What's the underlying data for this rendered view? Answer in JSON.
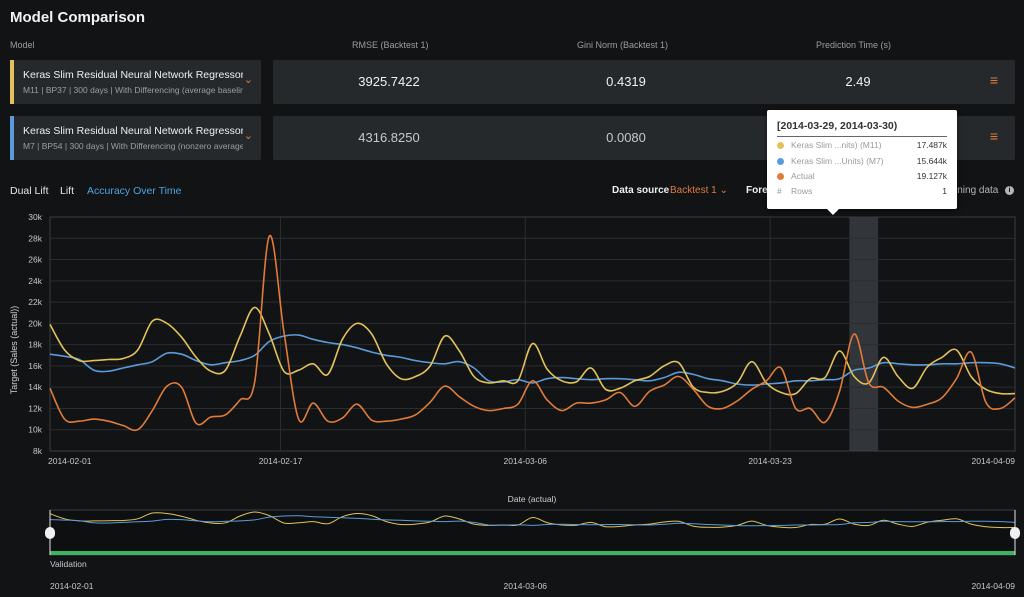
{
  "page_title": "Model Comparison",
  "columns": {
    "model": "Model",
    "rmse": "RMSE (Backtest 1)",
    "gini": "Gini Norm (Backtest 1)",
    "pred_time": "Prediction Time (s)"
  },
  "models": [
    {
      "name": "Keras Slim Residual Neural Network Regressor...",
      "sub": "M11 | BP37 | 300 days | With Differencing (average baseline)",
      "color": "#e3c25c",
      "rmse": "3925.7422",
      "gini": "0.4319",
      "pred_time": "2.49"
    },
    {
      "name": "Keras Slim Residual Neural Network Regressor...",
      "sub": "M7 | BP54 | 300 days | With Differencing (nonzero average baseline)",
      "color": "#5b9bd9",
      "rmse": "4316.8250",
      "gini": "0.0080",
      "pred_time": ""
    }
  ],
  "tabs": [
    "Dual Lift",
    "Lift",
    "Accuracy Over Time"
  ],
  "active_tab": "Accuracy Over Time",
  "data_source": {
    "label": "Data source",
    "value": "Backtest 1"
  },
  "forecast_label": "Fore",
  "training_label": "ining data",
  "tooltip": {
    "title": "[2014-03-29, 2014-03-30)",
    "rows": [
      {
        "label": "Keras Slim ...nits) (M11)",
        "value": "17.487k",
        "color": "#e3c25c"
      },
      {
        "label": "Keras Slim ...Units) (M7)",
        "value": "15.644k",
        "color": "#5b9bd9"
      },
      {
        "label": "Actual",
        "value": "19.127k",
        "color": "#e07b39"
      },
      {
        "label": "Rows",
        "value": "1",
        "color": ""
      }
    ]
  },
  "overview": {
    "partition_label": "Validation",
    "dates": [
      "2014-02-01",
      "2014-03-06",
      "2014-04-09"
    ]
  },
  "chart_data": {
    "type": "line",
    "xlabel": "Date (actual)",
    "ylabel": "Target (Sales (actual))",
    "ylim": [
      8000,
      30000
    ],
    "yticks": [
      8000,
      10000,
      12000,
      14000,
      16000,
      18000,
      20000,
      22000,
      24000,
      26000,
      28000,
      30000
    ],
    "ytick_labels": [
      "8k",
      "10k",
      "12k",
      "14k",
      "16k",
      "18k",
      "20k",
      "22k",
      "24k",
      "26k",
      "28k",
      "30k"
    ],
    "x_start": "2014-02-01",
    "x_end": "2014-04-09",
    "xtick_labels": [
      "2014-02-01",
      "2014-02-17",
      "2014-03-06",
      "2014-03-23",
      "2014-04-09"
    ],
    "grid": true,
    "highlight_range": [
      "2014-03-29",
      "2014-03-30"
    ],
    "series": [
      {
        "name": "Keras Slim ...nits) (M11)",
        "color": "#e3c25c",
        "values": [
          19900,
          17500,
          16500,
          16500,
          16600,
          16700,
          17500,
          20200,
          20000,
          18700,
          16800,
          15500,
          15600,
          18800,
          21500,
          19000,
          15500,
          15600,
          16200,
          15200,
          18500,
          20000,
          19000,
          16200,
          14800,
          15000,
          16000,
          18800,
          17400,
          15000,
          14400,
          14600,
          14600,
          18100,
          15700,
          14600,
          14500,
          15800,
          13800,
          13900,
          14600,
          15000,
          16000,
          16300,
          14000,
          13500,
          13600,
          14400,
          16400,
          14400,
          13500,
          13400,
          14800,
          14900,
          17400,
          15000,
          14400,
          16800,
          15000,
          13900,
          15900,
          16800,
          17500,
          15000,
          13800,
          13400,
          13400
        ]
      },
      {
        "name": "Keras Slim ...Units) (M7)",
        "color": "#5b9bd9",
        "values": [
          17100,
          16900,
          16600,
          15600,
          15500,
          15800,
          16100,
          16400,
          17200,
          17100,
          16500,
          16100,
          16300,
          16500,
          17000,
          18300,
          18800,
          18900,
          18500,
          18200,
          18000,
          17700,
          17300,
          17000,
          16800,
          16500,
          16300,
          16200,
          16400,
          15800,
          14600,
          14500,
          14700,
          14400,
          14800,
          14900,
          14800,
          14700,
          14800,
          14800,
          14700,
          14600,
          14900,
          15400,
          15200,
          14800,
          14600,
          14300,
          14200,
          14300,
          14400,
          14600,
          14600,
          14700,
          14800,
          15600,
          15800,
          16300,
          16200,
          16100,
          16100,
          16200,
          16200,
          16300,
          16300,
          16200,
          15800
        ]
      },
      {
        "name": "Actual",
        "color": "#e07b39",
        "values": [
          13900,
          11000,
          10800,
          11000,
          10800,
          10400,
          10000,
          11800,
          14100,
          14000,
          10600,
          11200,
          11400,
          12800,
          14500,
          28200,
          19200,
          11000,
          12500,
          10800,
          11100,
          12400,
          10900,
          10800,
          11000,
          11400,
          12600,
          14100,
          13100,
          12200,
          11800,
          12000,
          12400,
          14600,
          12800,
          11800,
          12500,
          12500,
          12800,
          13500,
          12200,
          13600,
          14200,
          15000,
          13800,
          12200,
          12000,
          12700,
          13800,
          14600,
          15800,
          12000,
          12000,
          10700,
          13600,
          19000,
          14400,
          14000,
          12700,
          12100,
          12400,
          13000,
          14800,
          17300,
          12600,
          12000,
          13000
        ]
      }
    ]
  }
}
